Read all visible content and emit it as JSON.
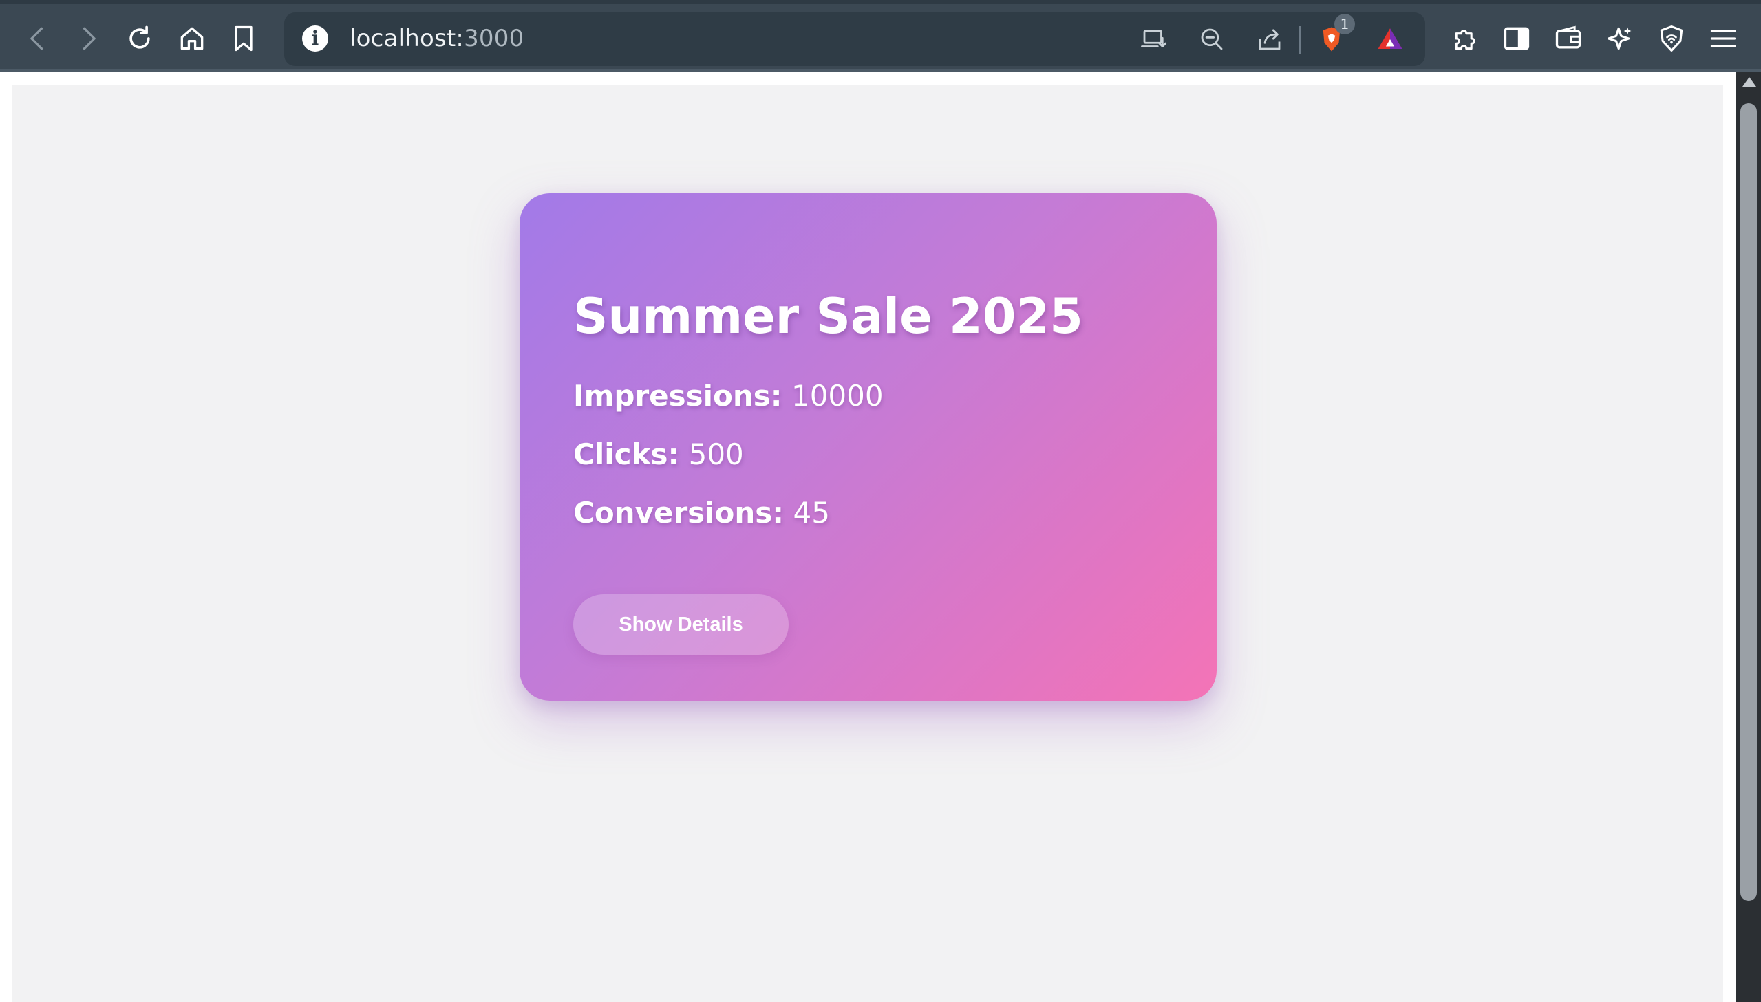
{
  "browser": {
    "url_host": "localhost:",
    "url_port": "3000",
    "shields_badge": "1",
    "icons": [
      "back-icon",
      "forward-icon",
      "reload-icon",
      "home-icon",
      "bookmark-icon",
      "info-icon",
      "install-app-icon",
      "zoom-out-icon",
      "share-icon",
      "brave-shields-icon",
      "brave-rewards-icon",
      "extensions-icon",
      "sidebar-icon",
      "wallet-icon",
      "leo-ai-icon",
      "vpn-icon",
      "menu-icon"
    ]
  },
  "card": {
    "title": "Summer Sale 2025",
    "stats": [
      {
        "label": "Impressions:",
        "value": "10000"
      },
      {
        "label": "Clicks:",
        "value": "500"
      },
      {
        "label": "Conversions:",
        "value": "45"
      }
    ],
    "button_label": "Show Details",
    "gradient_start": "#a27ae8",
    "gradient_end": "#f474b6"
  },
  "colors": {
    "toolbar": "#3b4853",
    "page_background": "#f2f2f3"
  }
}
